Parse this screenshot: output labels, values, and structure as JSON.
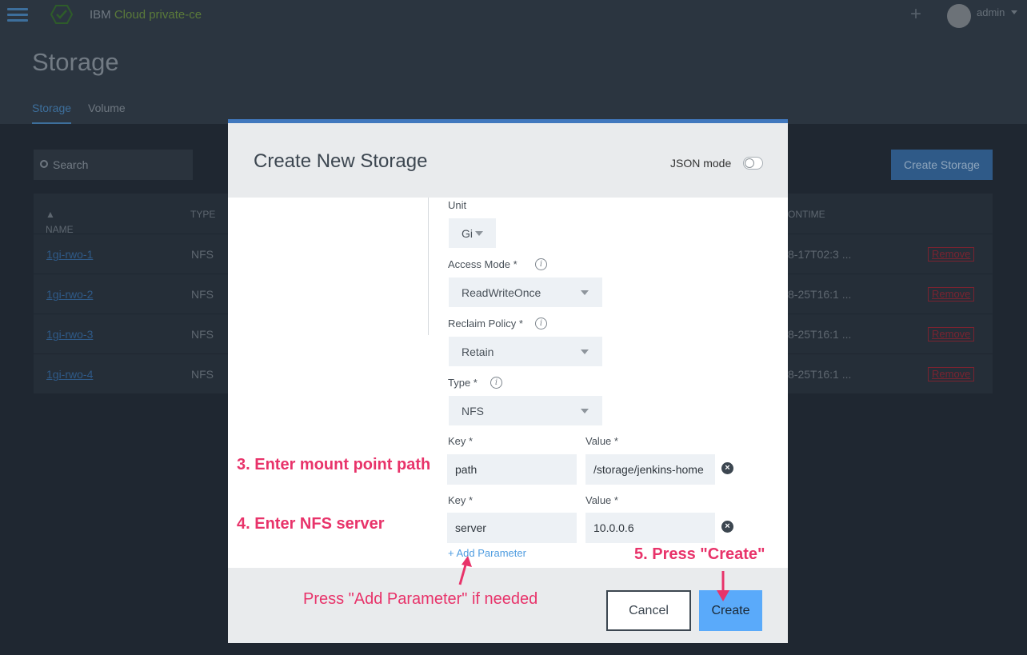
{
  "app": {
    "brand_prefix": "IBM ",
    "brand_name": "Cloud private-ce",
    "plus": "+",
    "user": "admin"
  },
  "page": {
    "title": "Storage",
    "tabs": [
      {
        "label": "Storage",
        "active": true
      },
      {
        "label": "Volume",
        "active": false
      }
    ],
    "search_placeholder": "Search",
    "create_storage": "Create Storage"
  },
  "table": {
    "headers": {
      "name": "NAME",
      "type": "TYPE",
      "time": "ONTIME"
    },
    "rows": [
      {
        "name": "1gi-rwo-1",
        "type": "NFS",
        "time": "8-17T02:3 ...",
        "action": "Remove"
      },
      {
        "name": "1gi-rwo-2",
        "type": "NFS",
        "time": "8-25T16:1 ...",
        "action": "Remove"
      },
      {
        "name": "1gi-rwo-3",
        "type": "NFS",
        "time": "8-25T16:1 ...",
        "action": "Remove"
      },
      {
        "name": "1gi-rwo-4",
        "type": "NFS",
        "time": "8-25T16:1 ...",
        "action": "Remove"
      }
    ]
  },
  "modal": {
    "title": "Create New Storage",
    "json_mode_label": "JSON mode",
    "json_mode_on": false,
    "unit": {
      "label": "Unit",
      "value": "Gi"
    },
    "access_mode": {
      "label": "Access Mode *",
      "value": "ReadWriteOnce"
    },
    "reclaim_policy": {
      "label": "Reclaim Policy *",
      "value": "Retain"
    },
    "type": {
      "label": "Type *",
      "value": "NFS"
    },
    "params": [
      {
        "key_label": "Key *",
        "key": "path",
        "value_label": "Value *",
        "value": "/storage/jenkins-home"
      },
      {
        "key_label": "Key *",
        "key": "server",
        "value_label": "Value *",
        "value": "10.0.0.6"
      }
    ],
    "add_parameter": "+ Add Parameter",
    "cancel": "Cancel",
    "create": "Create"
  },
  "annotations": {
    "step3": "3. Enter mount point path",
    "step4": "4. Enter NFS server",
    "step5": "5. Press \"Create\"",
    "hint": "Press \"Add Parameter\" if needed"
  },
  "colors": {
    "accent": "#4178be",
    "create_button": "#5aaafa",
    "annotation": "#e8336a",
    "danger": "#7a2330"
  }
}
